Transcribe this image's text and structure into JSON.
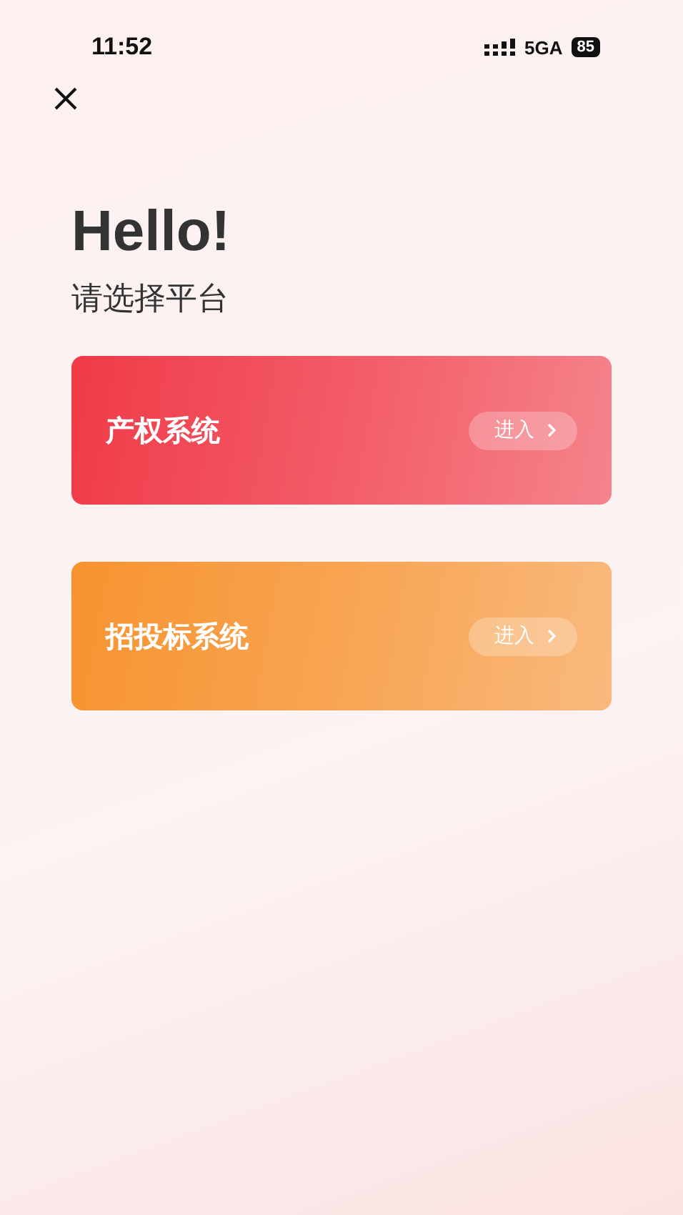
{
  "status_bar": {
    "time": "11:52",
    "network": "5GA",
    "battery": "85"
  },
  "greeting": "Hello!",
  "subtitle": "请选择平台",
  "platforms": [
    {
      "name": "产权系统",
      "action": "进入",
      "color": "#f03a48"
    },
    {
      "name": "招投标系统",
      "action": "进入",
      "color": "#f7932f"
    }
  ]
}
